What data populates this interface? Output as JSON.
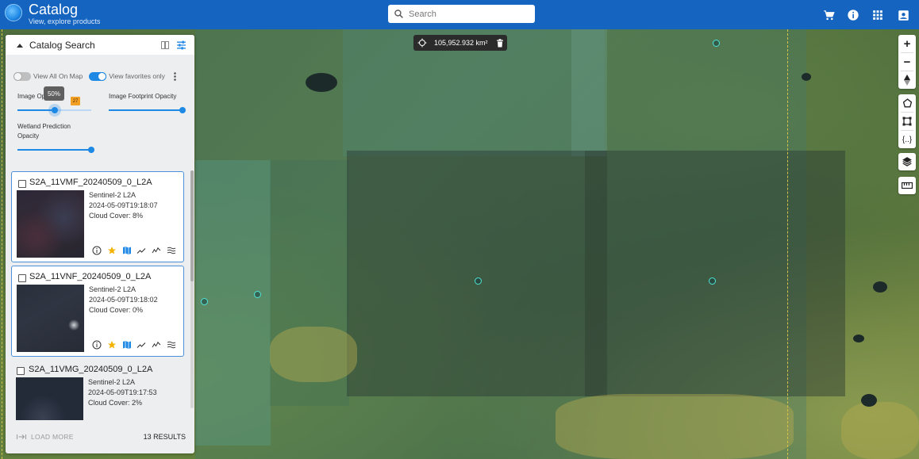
{
  "header": {
    "title": "Catalog",
    "subtitle": "View, explore products",
    "search_placeholder": "Search",
    "icons": [
      "cart-icon",
      "info-icon",
      "apps-grid-icon",
      "account-icon"
    ]
  },
  "map": {
    "area_measure": "105,952.932 km²",
    "controls": [
      "zoom-in-icon",
      "zoom-out-icon",
      "compass-icon",
      "polygon-draw-icon",
      "rectangle-draw-icon",
      "geojson-icon",
      "layers-icon",
      "ruler-icon"
    ]
  },
  "panel": {
    "title": "Catalog Search",
    "toggles": {
      "view_all_label": "View All On Map",
      "view_all_on": false,
      "favorites_label": "View favorites only",
      "favorites_on": true
    },
    "sliders": {
      "image_opacity_label": "Image Op",
      "image_opacity_value": 50,
      "image_opacity_tooltip": "50%",
      "badge_value": "27",
      "footprint_label": "Image Footprint Opacity",
      "footprint_value": 100,
      "wetland_label_line1": "Wetland Prediction",
      "wetland_label_line2": "Opacity",
      "wetland_value": 100
    },
    "results": [
      {
        "name": "S2A_11VMF_20240509_0_L2A",
        "product": "Sentinel-2 L2A",
        "datetime": "2024-05-09T19:18:07",
        "cloud": "Cloud Cover: 8%",
        "favorite": true,
        "selected": true
      },
      {
        "name": "S2A_11VNF_20240509_0_L2A",
        "product": "Sentinel-2 L2A",
        "datetime": "2024-05-09T19:18:02",
        "cloud": "Cloud Cover: 0%",
        "favorite": true,
        "selected": true
      },
      {
        "name": "S2A_11VMG_20240509_0_L2A",
        "product": "Sentinel-2 L2A",
        "datetime": "2024-05-09T19:17:53",
        "cloud": "Cloud Cover: 2%",
        "favorite": false,
        "selected": false
      }
    ],
    "load_more_label": "LOAD MORE",
    "results_count": "13 RESULTS"
  },
  "colors": {
    "header_bg": "#1565c0",
    "accent": "#1e88e5",
    "favorite_star": "#f5b301",
    "footprint_point": "#4fe3d8"
  }
}
